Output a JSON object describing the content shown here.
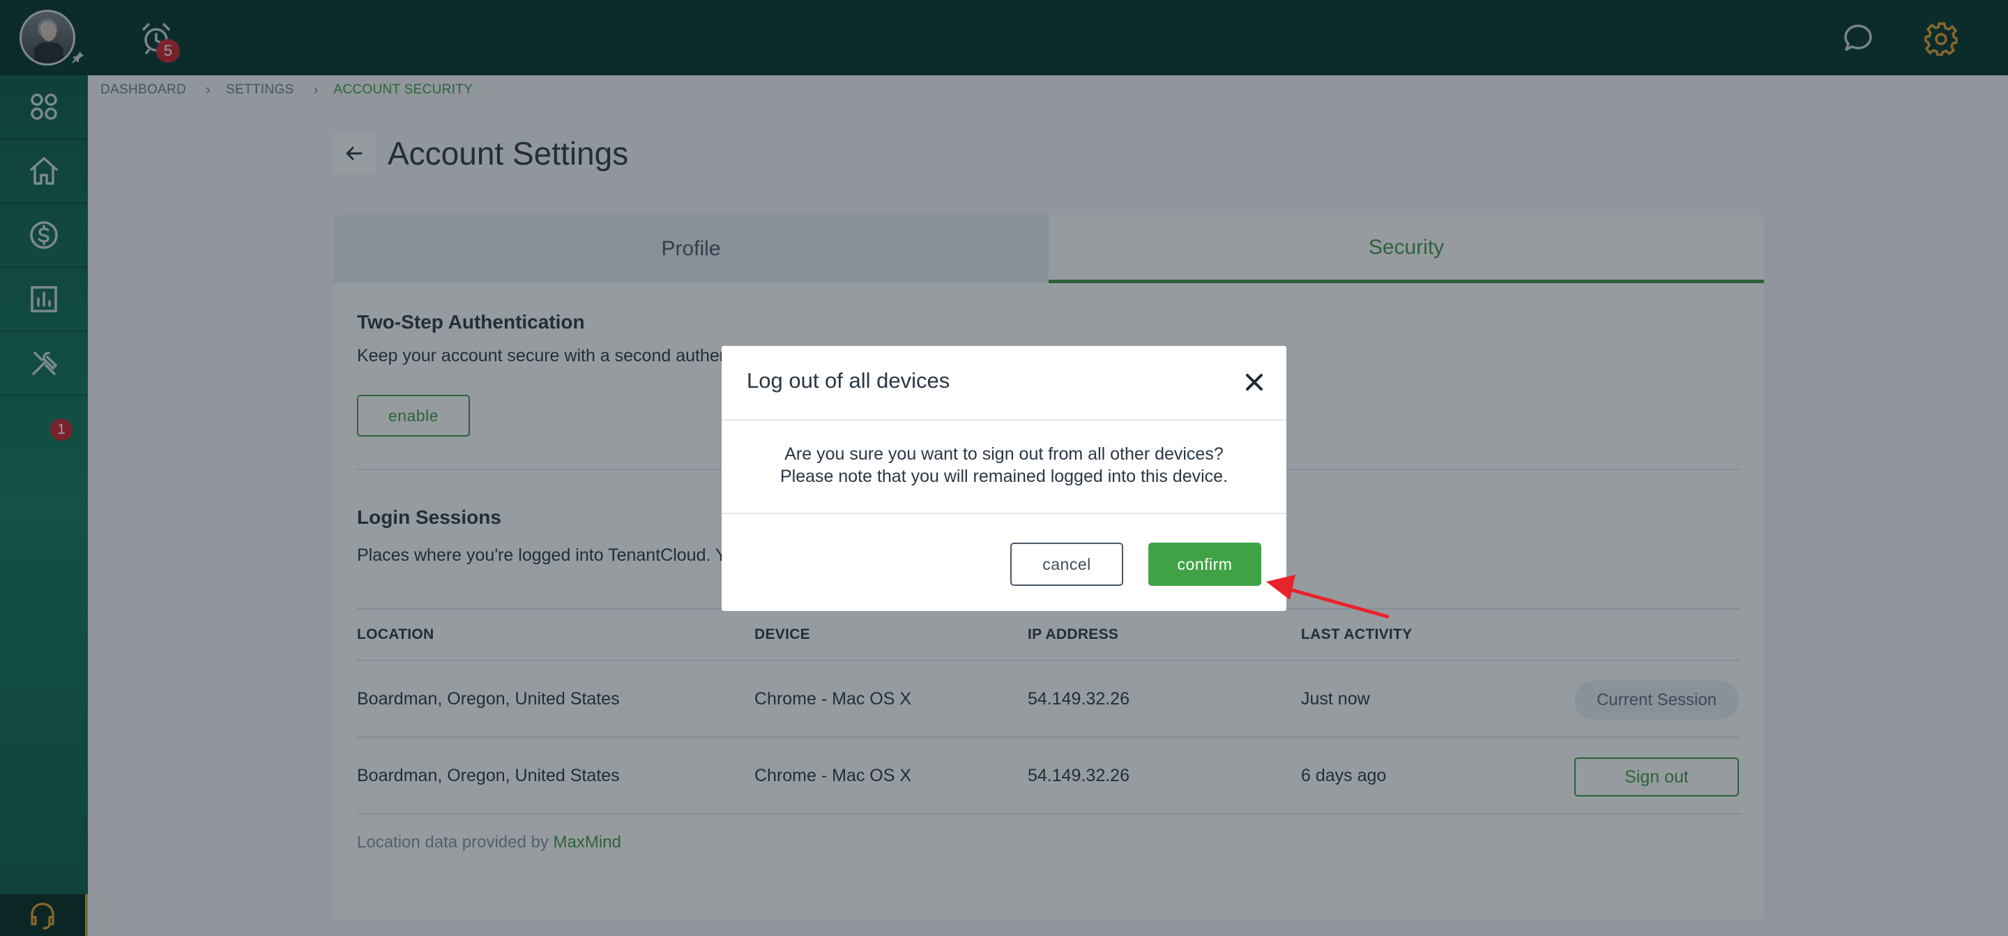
{
  "colors": {
    "topbar": "#05352b",
    "sidebar": "#0c6b4f",
    "accent_green": "#3f9a42",
    "gear_orange": "#e3a22d",
    "badge_red": "#c9262b",
    "annotation_arrow": "#e8232a"
  },
  "topbar": {
    "icons": [
      "avatar",
      "pin-icon",
      "alarm-clock-icon",
      "chat-bubble-icon",
      "gear-icon"
    ],
    "alarm_badge": "5"
  },
  "sidebar": {
    "items": [
      {
        "icon": "apps-grid-icon"
      },
      {
        "icon": "home-icon"
      },
      {
        "icon": "dollar-icon"
      },
      {
        "icon": "bar-chart-icon"
      },
      {
        "icon": "tools-icon",
        "badge": "1"
      }
    ],
    "support_icon": "headset-icon"
  },
  "breadcrumb": {
    "items": [
      "DASHBOARD",
      "SETTINGS",
      "ACCOUNT SECURITY"
    ]
  },
  "page": {
    "title": "Account Settings"
  },
  "tabs": [
    {
      "label": "Profile",
      "active": false
    },
    {
      "label": "Security",
      "active": true
    }
  ],
  "two_step": {
    "title": "Two-Step Authentication",
    "description": "Keep your account secure with a second authen",
    "button": "enable"
  },
  "sessions": {
    "title": "Login Sessions",
    "description": "Places where you're logged into TenantCloud. Y",
    "columns": [
      "LOCATION",
      "DEVICE",
      "IP ADDRESS",
      "LAST ACTIVITY"
    ],
    "rows": [
      {
        "location": "Boardman, Oregon, United States",
        "device": "Chrome - Mac OS X",
        "ip": "54.149.32.26",
        "activity": "Just now",
        "action": "Current Session"
      },
      {
        "location": "Boardman, Oregon, United States",
        "device": "Chrome - Mac OS X",
        "ip": "54.149.32.26",
        "activity": "6 days ago",
        "action": "Sign out"
      }
    ],
    "footnote_prefix": "Location data provided by ",
    "footnote_link": "MaxMind"
  },
  "modal": {
    "title": "Log out of all devices",
    "line1": "Are you sure you want to sign out from all other devices?",
    "line2": "Please note that you will remained logged into this device.",
    "cancel": "cancel",
    "confirm": "confirm"
  }
}
